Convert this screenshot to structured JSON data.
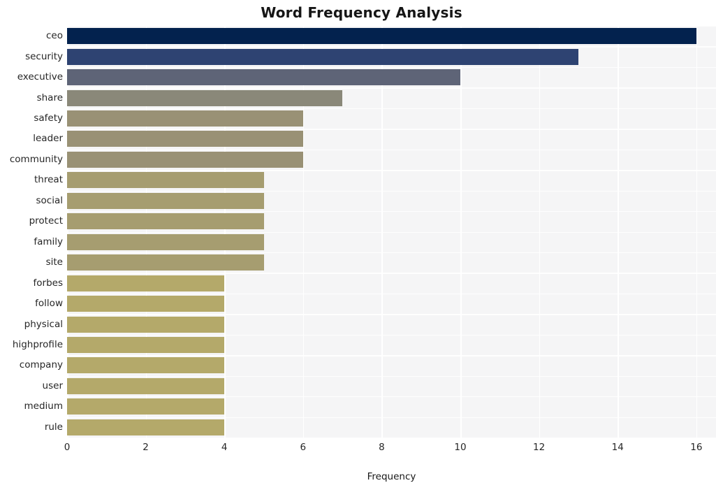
{
  "chart_data": {
    "type": "bar",
    "orientation": "horizontal",
    "title": "Word Frequency Analysis",
    "xlabel": "Frequency",
    "ylabel": "",
    "xlim": [
      0,
      16.5
    ],
    "xticks": [
      0,
      2,
      4,
      6,
      8,
      10,
      12,
      14,
      16
    ],
    "grid": true,
    "legend": null,
    "categories": [
      "ceo",
      "security",
      "executive",
      "share",
      "safety",
      "leader",
      "community",
      "threat",
      "social",
      "protect",
      "family",
      "site",
      "forbes",
      "follow",
      "physical",
      "highprofile",
      "company",
      "user",
      "medium",
      "rule"
    ],
    "values": [
      16,
      13,
      10,
      7,
      6,
      6,
      6,
      5,
      5,
      5,
      5,
      5,
      4,
      4,
      4,
      4,
      4,
      4,
      4,
      4
    ],
    "bar_colors": [
      "#03224e",
      "#2e4372",
      "#5e6477",
      "#8a8879",
      "#999175",
      "#999175",
      "#999175",
      "#a69d70",
      "#a69d70",
      "#a69d70",
      "#a69d70",
      "#a69d70",
      "#b4a96a",
      "#b4a96a",
      "#b4a96a",
      "#b4a96a",
      "#b4a96a",
      "#b4a96a",
      "#b4a96a",
      "#b4a96a"
    ],
    "plot_background": "#f5f5f6",
    "grid_color": "#ffffff",
    "figure_background": "#ffffff"
  }
}
